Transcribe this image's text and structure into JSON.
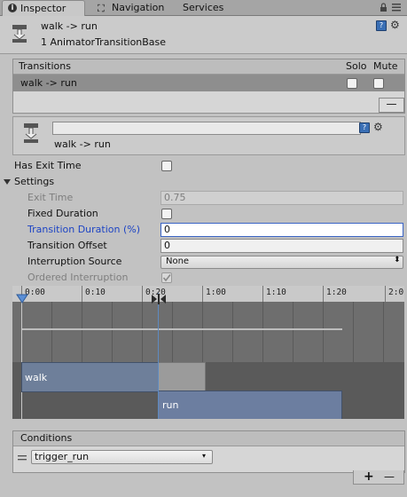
{
  "tabs": [
    {
      "label": "Inspector",
      "icon": "info-icon",
      "active": true
    },
    {
      "label": "Navigation",
      "icon": "navigation-icon",
      "active": false
    },
    {
      "label": "Services",
      "active": false
    }
  ],
  "header": {
    "title": "walk -> run",
    "subtitle": "1 AnimatorTransitionBase"
  },
  "transitions": {
    "header": {
      "name": "Transitions",
      "solo": "Solo",
      "mute": "Mute"
    },
    "rows": [
      {
        "name": "walk -> run",
        "solo": false,
        "mute": false
      }
    ],
    "remove_label": "—"
  },
  "transition": {
    "name_field_value": "",
    "label": "walk -> run",
    "has_exit_time_label": "Has Exit Time",
    "has_exit_time": false,
    "settings_label": "Settings",
    "exit_time_label": "Exit Time",
    "exit_time_value": "0.75",
    "fixed_duration_label": "Fixed Duration",
    "fixed_duration": false,
    "duration_label": "Transition Duration (%)",
    "duration_value": "0",
    "offset_label": "Transition Offset",
    "offset_value": "0",
    "interruption_label": "Interruption Source",
    "interruption_value": "None",
    "ordered_label": "Ordered Interruption",
    "ordered": true
  },
  "timeline": {
    "ticks": [
      "0:00",
      "0:10",
      "0:20",
      "1:00",
      "1:10",
      "1:20",
      "2:0"
    ],
    "clip_from": "walk",
    "clip_to": "run"
  },
  "conditions": {
    "title": "Conditions",
    "items": [
      {
        "parameter": "trigger_run"
      }
    ],
    "add_label": "+",
    "remove_label": "—"
  },
  "colors": {
    "selection": "#8e8e8e",
    "focus": "#3b64c4",
    "clip": "#6e7f9a"
  }
}
